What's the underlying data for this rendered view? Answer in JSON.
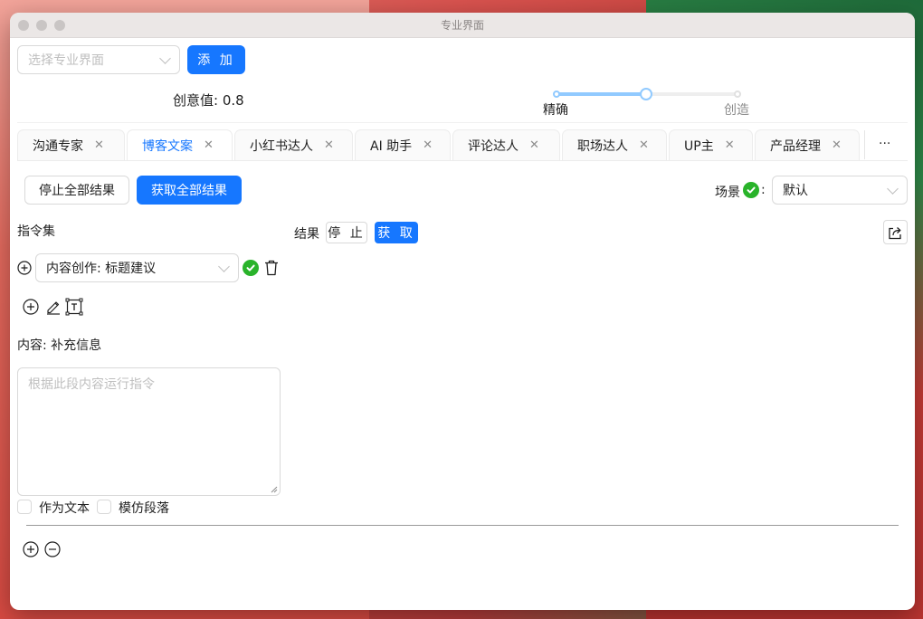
{
  "window": {
    "title": "专业界面"
  },
  "top": {
    "select_placeholder": "选择专业界面",
    "add_label": "添 加",
    "creativity_label": "创意值: 0.8",
    "creativity_value": 0.8,
    "slider_marks": [
      "精确",
      "创造"
    ]
  },
  "tabs": [
    {
      "label": "沟通专家"
    },
    {
      "label": "博客文案"
    },
    {
      "label": "小红书达人"
    },
    {
      "label": "AI 助手"
    },
    {
      "label": "评论达人"
    },
    {
      "label": "职场达人"
    },
    {
      "label": "UP主"
    },
    {
      "label": "产品经理"
    }
  ],
  "tabs_more": "···",
  "toolbar": {
    "stop_all_label": "停止全部结果",
    "get_all_label": "获取全部结果",
    "scene_label": "场景",
    "scene_colon": ":",
    "scene_value": "默认"
  },
  "left": {
    "instruction_set_label": "指令集",
    "instruction_value": "内容创作: 标题建议",
    "content_label": "内容: 补充信息",
    "textarea_placeholder": "根据此段内容运行指令",
    "checkbox_as_text": "作为文本",
    "checkbox_imitate": "模仿段落"
  },
  "result": {
    "label": "结果",
    "stop_label": "停 止",
    "get_label": "获 取"
  },
  "colors": {
    "primary": "#1677ff",
    "success": "#29b32a",
    "slider": "#91caff"
  }
}
